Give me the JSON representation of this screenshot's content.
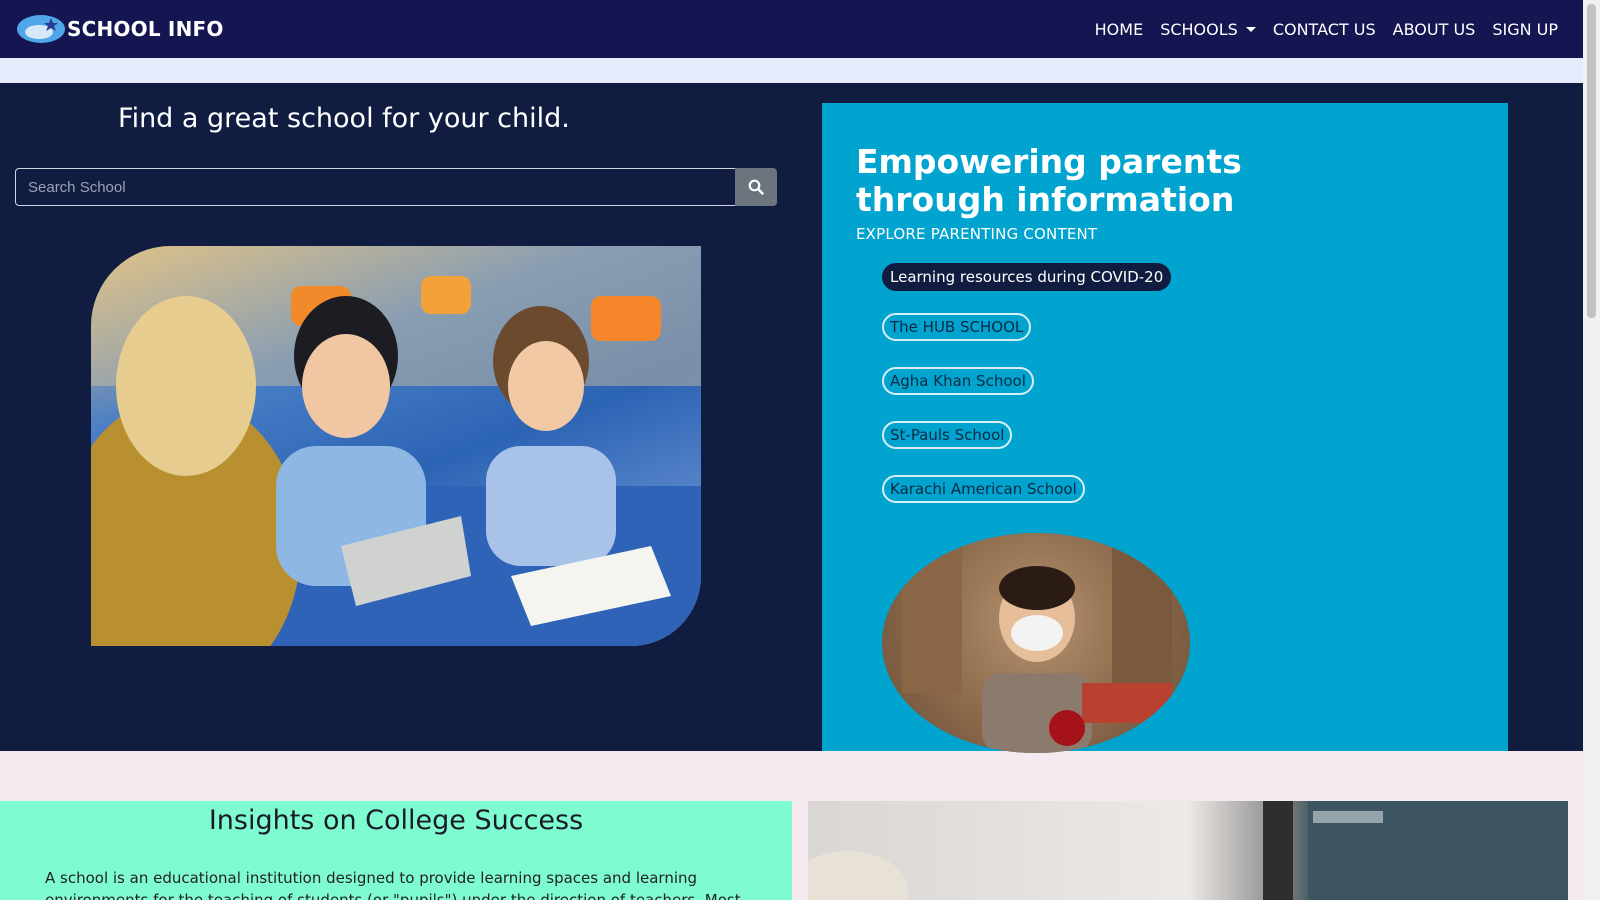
{
  "navbar": {
    "brand": "SCHOOL INFO",
    "links": [
      "HOME",
      "SCHOOLS",
      "CONTACT US",
      "ABOUT US",
      "SIGN UP"
    ]
  },
  "hero": {
    "title": "Find a great school for your child.",
    "search": {
      "placeholder": "Search School"
    }
  },
  "panel": {
    "title": "Empowering parents through information",
    "subtitle": "EXPLORE PARENTING CONTENT",
    "pills": [
      "Learning resources during COVID-20",
      "The HUB SCHOOL",
      "Agha Khan School",
      "St-Pauls School",
      "Karachi American School"
    ]
  },
  "insights": {
    "title": "Insights on College Success",
    "text": "A school is an educational institution designed to provide learning spaces and learning environments for the teaching of students (or \"pupils\") under the direction of teachers. Most"
  },
  "colors": {
    "navbar": "#141551",
    "hero": "#101d40",
    "panel": "#00a4cf",
    "insights": "#7ffccf"
  }
}
